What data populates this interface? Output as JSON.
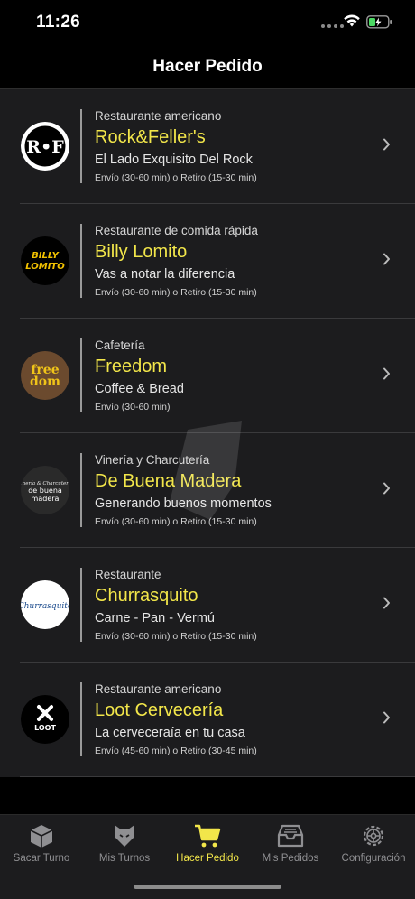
{
  "status_bar": {
    "time": "11:26"
  },
  "header": {
    "title": "Hacer Pedido"
  },
  "restaurants": [
    {
      "logo_text": "R•F",
      "category": "Restaurante americano",
      "name": "Rock&Feller's",
      "tagline": "El Lado Exquisito Del Rock",
      "delivery": "Envío (30-60 min) o Retiro (15-30 min)"
    },
    {
      "logo_text": "BILLY LOMITO",
      "category": "Restaurante de comida rápida",
      "name": "Billy Lomito",
      "tagline": "Vas a notar la diferencia",
      "delivery": "Envío (30-60 min) o Retiro (15-30 min)"
    },
    {
      "logo_text": "free dom",
      "category": "Cafetería",
      "name": "Freedom",
      "tagline": "Coffee & Bread",
      "delivery": "Envío (30-60 min)"
    },
    {
      "logo_text": "Vinería & Charcutería de buena madera",
      "category": "Vinería y Charcutería",
      "name": "De Buena Madera",
      "tagline": "Generando buenos momentos",
      "delivery": "Envío (30-60 min) o Retiro (15-30 min)"
    },
    {
      "logo_text": "Churrasquito",
      "category": "Restaurante",
      "name": "Churrasquito",
      "tagline": "Carne - Pan - Vermú",
      "delivery": "Envío (30-60 min) o Retiro (15-30 min)"
    },
    {
      "logo_text": "LOOT",
      "category": "Restaurante americano",
      "name": "Loot Cervecería",
      "tagline": "La cerveceraía en tu casa",
      "delivery": "Envío (45-60 min) o Retiro (30-45 min)"
    }
  ],
  "tabs": [
    {
      "label": "Sacar Turno",
      "icon": "box-icon"
    },
    {
      "label": "Mis Turnos",
      "icon": "fox-icon"
    },
    {
      "label": "Hacer Pedido",
      "icon": "cart-icon",
      "active": true
    },
    {
      "label": "Mis Pedidos",
      "icon": "inbox-icon"
    },
    {
      "label": "Configuración",
      "icon": "gear-icon"
    }
  ],
  "colors": {
    "accent": "#f2e64a",
    "background": "#1c1c1e",
    "inactive_tab": "#8f8f92"
  }
}
